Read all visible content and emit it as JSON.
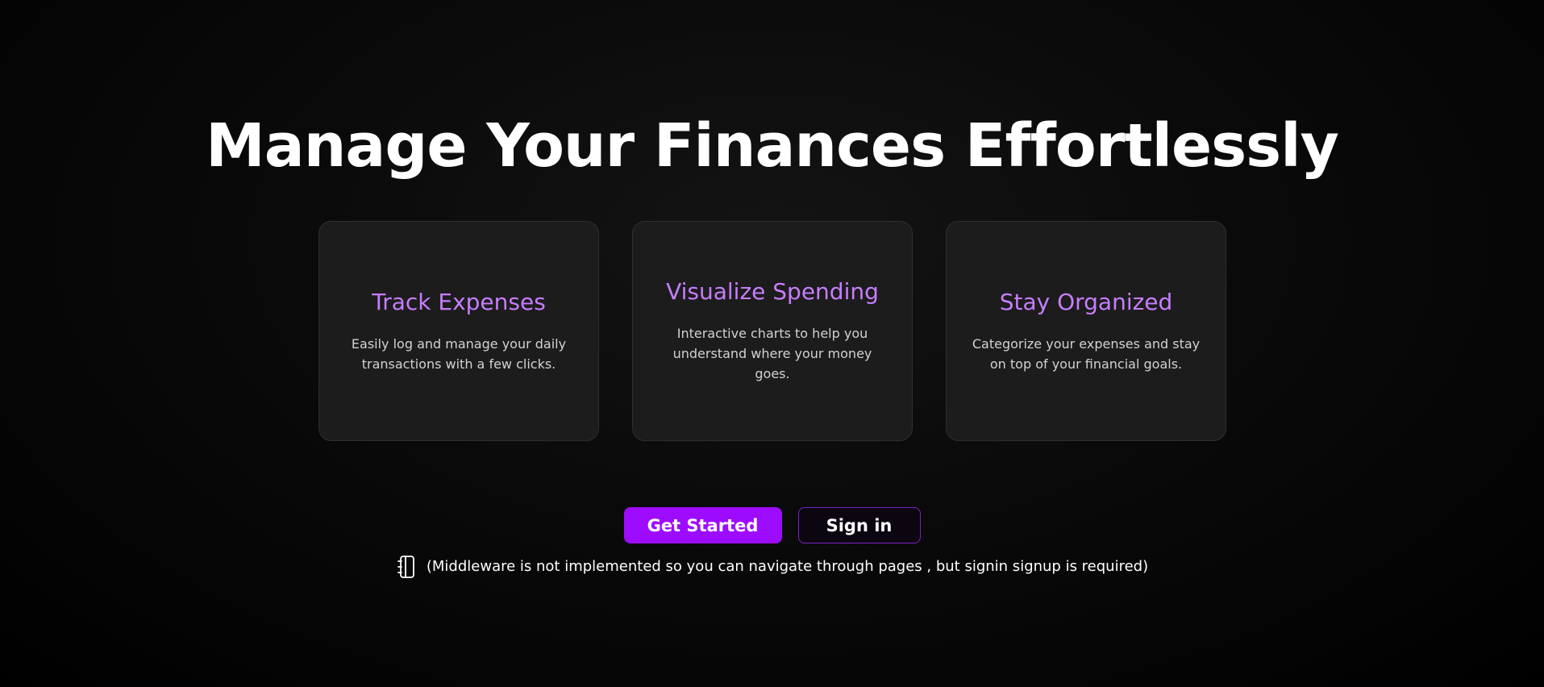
{
  "hero": {
    "title": "Manage Your Finances Effortlessly"
  },
  "features": [
    {
      "title": "Track Expenses",
      "description": "Easily log and manage your daily transactions with a few clicks."
    },
    {
      "title": "Visualize Spending",
      "description": "Interactive charts to help you understand where your money goes."
    },
    {
      "title": "Stay Organized",
      "description": "Categorize your expenses and stay on top of your financial goals."
    }
  ],
  "actions": {
    "get_started_label": "Get Started",
    "sign_in_label": "Sign in"
  },
  "note": {
    "icon": "notebook-icon",
    "text": "(Middleware is not implemented so you can navigate through pages , but signin signup is required)"
  },
  "colors": {
    "accent": "#9d0cff",
    "feature_title": "#c77dff",
    "card_bg": "#1c1c1c",
    "background": "#050505"
  }
}
